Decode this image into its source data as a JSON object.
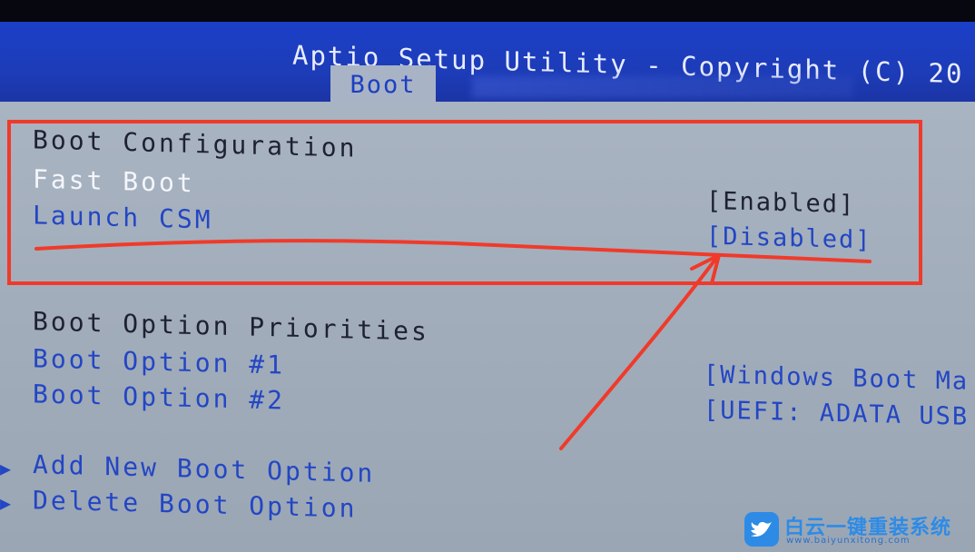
{
  "header": {
    "title": "Aptio Setup Utility - Copyright (C) 20",
    "active_tab": "Boot"
  },
  "boot_configuration": {
    "heading": "Boot Configuration",
    "items": [
      {
        "label": "Fast Boot",
        "value": "[Enabled]",
        "highlighted": true
      },
      {
        "label": "Launch CSM",
        "value": "[Disabled]",
        "highlighted": false
      }
    ]
  },
  "boot_priorities": {
    "heading": "Boot Option Priorities",
    "items": [
      {
        "label": "Boot Option #1",
        "value": "[Windows Boot Ma"
      },
      {
        "label": "Boot Option #2",
        "value": "[UEFI: ADATA USB"
      }
    ]
  },
  "submenus": [
    {
      "label": "Add New Boot Option"
    },
    {
      "label": "Delete Boot Option"
    }
  ],
  "watermark": {
    "name": "白云一键重装系统",
    "url": "www.baiyunxitong.com"
  },
  "colors": {
    "header_blue": "#1d3cb8",
    "panel_gray": "#a5b0be",
    "option_blue": "#2346c4",
    "annotation_red": "#f03a2a"
  },
  "icons": {
    "submenu": "triangle-right-icon",
    "watermark": "bird-icon"
  }
}
